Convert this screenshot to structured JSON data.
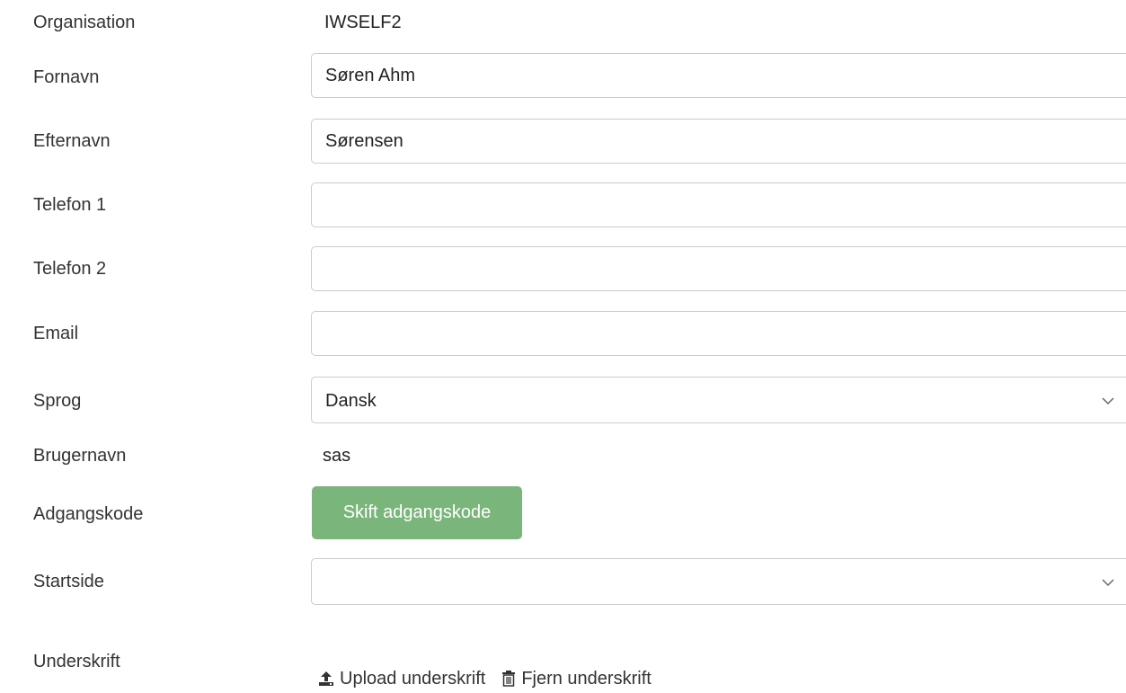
{
  "fields": {
    "organisation": {
      "label": "Organisation",
      "value": "IWSELF2"
    },
    "fornavn": {
      "label": "Fornavn",
      "value": "Søren Ahm"
    },
    "efternavn": {
      "label": "Efternavn",
      "value": "Sørensen"
    },
    "telefon1": {
      "label": "Telefon 1",
      "value": ""
    },
    "telefon2": {
      "label": "Telefon 2",
      "value": ""
    },
    "email": {
      "label": "Email",
      "value": ""
    },
    "sprog": {
      "label": "Sprog",
      "selected": "Dansk"
    },
    "brugernavn": {
      "label": "Brugernavn",
      "value": "sas"
    },
    "adgangskode": {
      "label": "Adgangskode",
      "button": "Skift adgangskode"
    },
    "startside": {
      "label": "Startside",
      "selected": ""
    },
    "underskrift": {
      "label": "Underskrift",
      "upload": "Upload underskrift",
      "remove": "Fjern underskrift"
    }
  },
  "colors": {
    "button_green": "#7ab57b",
    "border": "#cccccc",
    "text": "#333333"
  },
  "icons": [
    "chevron-down-icon",
    "upload-icon",
    "trash-icon"
  ]
}
